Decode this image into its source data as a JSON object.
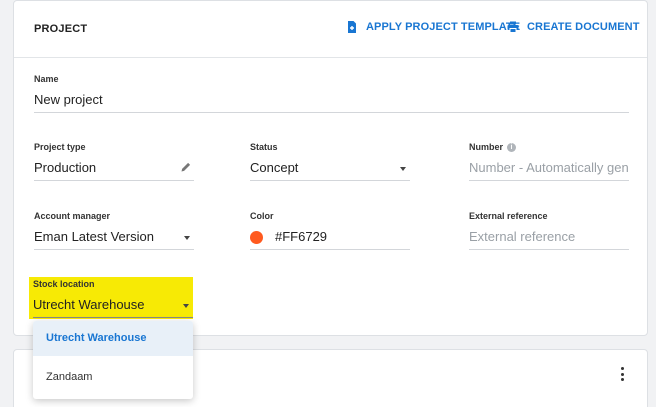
{
  "project": {
    "title": "PROJECT",
    "actions": {
      "apply_template": "APPLY PROJECT TEMPLATE",
      "create_document": "CREATE DOCUMENT"
    },
    "name": {
      "label": "Name",
      "value": "New project"
    },
    "project_type": {
      "label": "Project type",
      "value": "Production"
    },
    "status": {
      "label": "Status",
      "value": "Concept"
    },
    "number": {
      "label": "Number",
      "placeholder": "Number - Automatically gene"
    },
    "account_manager": {
      "label": "Account manager",
      "value": "Eman Latest Version"
    },
    "color": {
      "label": "Color",
      "value": "#FF6729",
      "swatch": "#ff5a1f"
    },
    "external_reference": {
      "label": "External reference",
      "placeholder": "External reference"
    },
    "stock_location": {
      "label": "Stock location",
      "value": "Utrecht Warehouse",
      "options": [
        "Utrecht Warehouse",
        "Zandaam"
      ]
    }
  },
  "colors": {
    "accent": "#1976d2",
    "highlight": "#f7ea05"
  }
}
